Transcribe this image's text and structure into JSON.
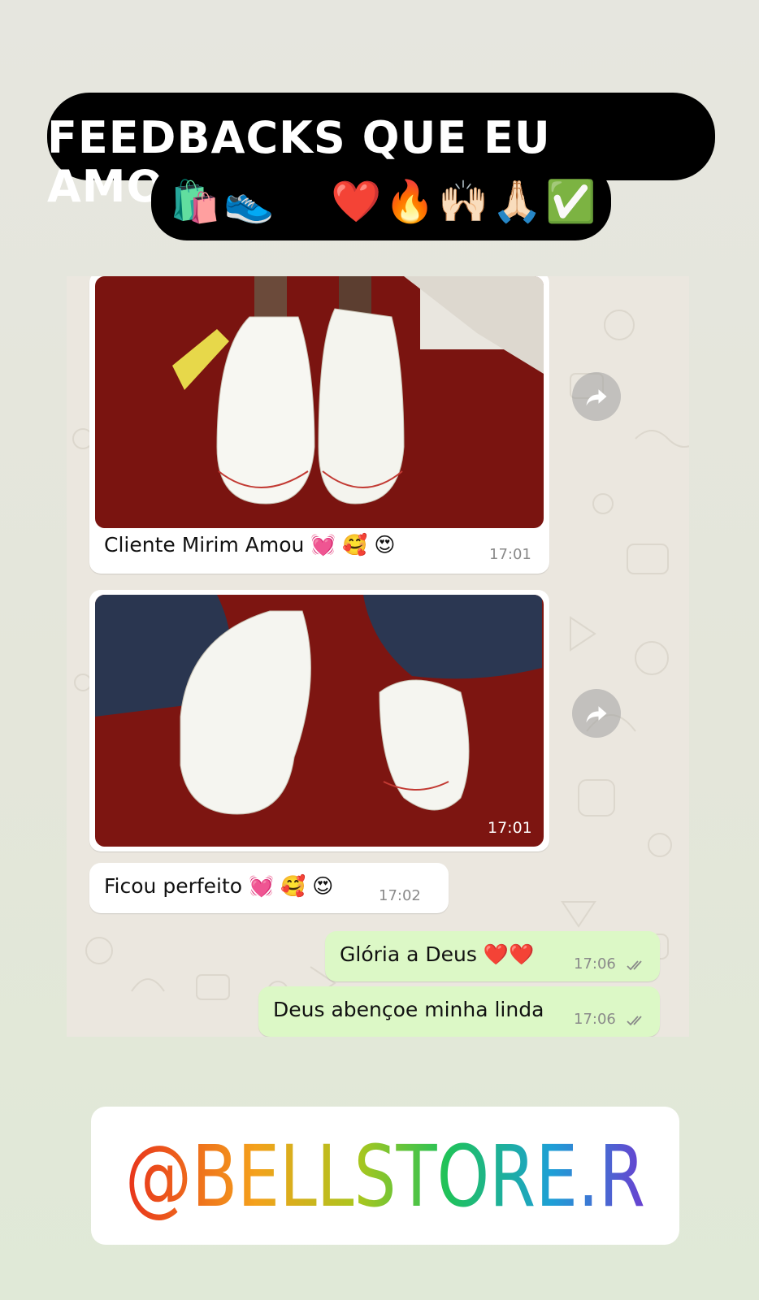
{
  "header": {
    "title": "FEEDBACKS QUE EU AMOOO",
    "emojis": [
      "🛍️",
      "👟",
      "😍",
      "❤️",
      "🔥",
      "🙌🏻",
      "🙏🏻",
      "✅"
    ]
  },
  "chat": {
    "messages": [
      {
        "type": "image",
        "caption": "Cliente Mirim Amou 💓 🥰 😍",
        "time": "17:01"
      },
      {
        "type": "image",
        "caption": "",
        "time": "17:01"
      },
      {
        "type": "text",
        "direction": "in",
        "text": "Ficou perfeito 💓 🥰 😍",
        "time": "17:02"
      },
      {
        "type": "text",
        "direction": "out",
        "text": "Glória a Deus ❤️❤️",
        "time": "17:06",
        "status": "read"
      },
      {
        "type": "text",
        "direction": "out",
        "text": "Deus abençoe minha linda",
        "time": "17:06",
        "status": "read"
      }
    ]
  },
  "mention": {
    "handle": "@BELLSTORE.R",
    "icon": "threads-icon",
    "gradient": [
      "#e8331c",
      "#f4a11c",
      "#a9c61e",
      "#1fc25a",
      "#1e9fd6",
      "#6a3fd0"
    ]
  },
  "colors": {
    "incoming_bubble": "#ffffff",
    "outgoing_bubble": "#dcf8c6",
    "chat_background": "#ebe7df"
  }
}
